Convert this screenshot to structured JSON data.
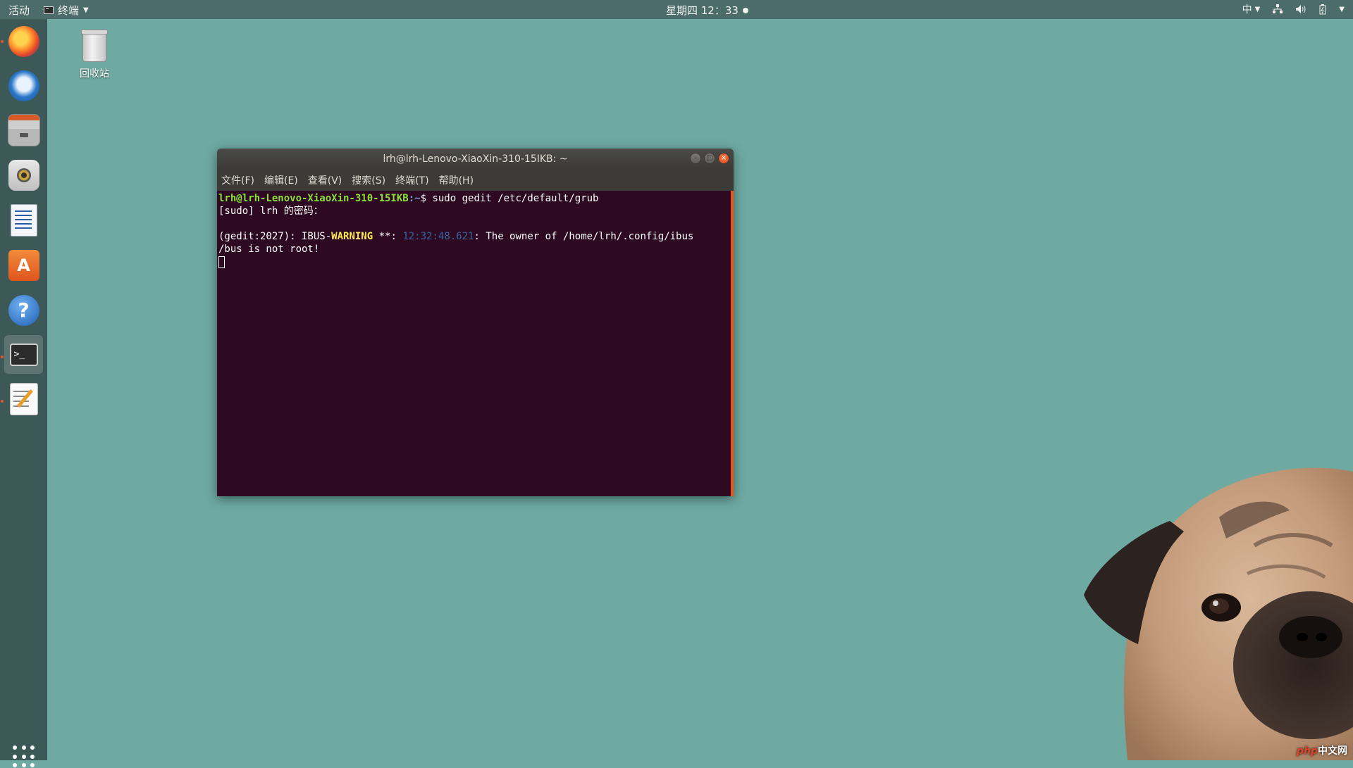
{
  "topbar": {
    "activities": "活动",
    "app_name": "终端",
    "clock": "星期四 12：33",
    "input_method": "中"
  },
  "dock": {
    "items": [
      {
        "name": "firefox",
        "icon": "firefox-icon"
      },
      {
        "name": "thunderbird",
        "icon": "thunderbird-icon"
      },
      {
        "name": "files",
        "icon": "files-icon"
      },
      {
        "name": "rhythmbox",
        "icon": "rhythmbox-icon"
      },
      {
        "name": "libreoffice-writer",
        "icon": "writer-icon"
      },
      {
        "name": "software",
        "icon": "software-center-icon"
      },
      {
        "name": "help",
        "icon": "help-icon"
      },
      {
        "name": "terminal",
        "icon": "terminal-icon"
      },
      {
        "name": "text-editor",
        "icon": "text-editor-icon"
      }
    ],
    "store_glyph": "A",
    "help_glyph": "?",
    "terminal_glyph": ">_"
  },
  "desktop": {
    "trash_label": "回收站"
  },
  "terminal": {
    "title": "lrh@lrh-Lenovo-XiaoXin-310-15IKB: ~",
    "menu": [
      "文件(F)",
      "编辑(E)",
      "查看(V)",
      "搜索(S)",
      "终端(T)",
      "帮助(H)"
    ],
    "prompt_user": "lrh@lrh-Lenovo-XiaoXin-310-15IKB",
    "prompt_path": ":~",
    "prompt_symbol": "$ ",
    "command": "sudo gedit /etc/default/grub",
    "line2": "[sudo] lrh 的密码：",
    "warn_prefix": "(gedit:2027): IBUS-",
    "warn_word": "WARNING",
    "warn_stars": " **: ",
    "warn_time": "12:32:48.621",
    "warn_msg": ": The owner of /home/lrh/.config/ibus",
    "line4": "/bus is not root!"
  },
  "watermark": {
    "php": "php",
    "site": "中文网"
  },
  "colors": {
    "desktop_bg": "#6eaaa2",
    "terminal_bg": "#2d0922",
    "accent": "#e95420"
  }
}
